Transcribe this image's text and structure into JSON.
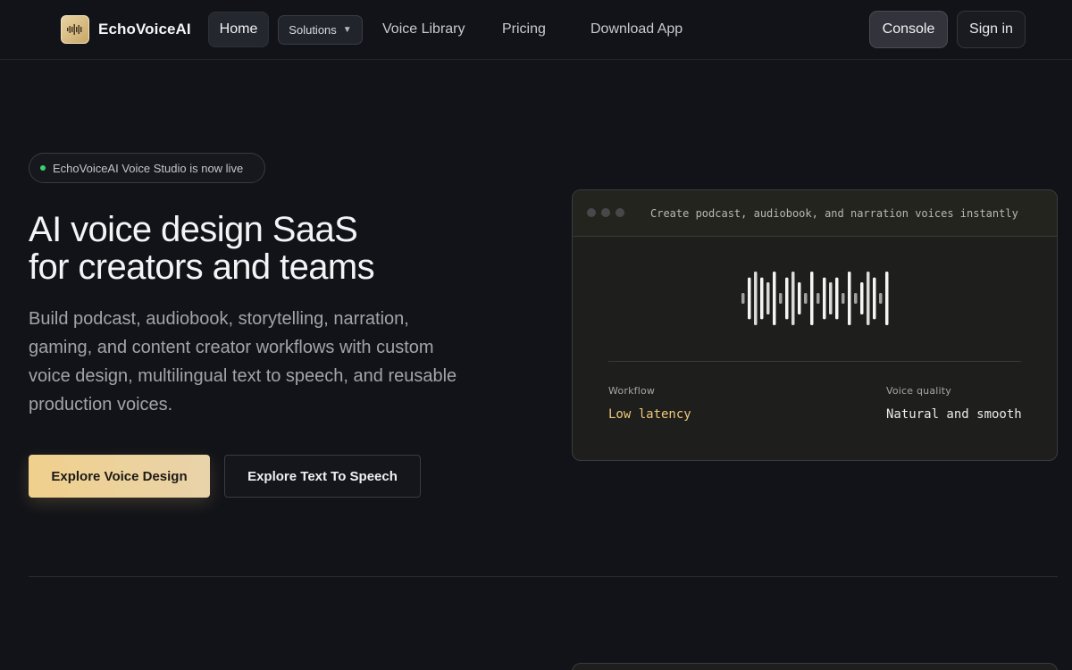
{
  "brand": {
    "name": "EchoVoiceAI",
    "logo_icon": "waveform-icon",
    "logo_color": "#e9d3a1"
  },
  "nav": {
    "home": "Home",
    "solutions": "Solutions",
    "voice_library": "Voice Library",
    "pricing": "Pricing",
    "download": "Download App",
    "console": "Console",
    "signin": "Sign in"
  },
  "hero": {
    "badge": "EchoVoiceAI Voice Studio is now live",
    "badge_status_color": "#3ecf6e",
    "title_line1": "AI voice design SaaS",
    "title_line2": "for creators and teams",
    "description": "Build podcast, audiobook, storytelling, narration, gaming, and content creator workflows with custom voice design, multilingual text to speech, and reusable production voices.",
    "primary_cta": "Explore Voice Design",
    "secondary_cta": "Explore Text To Speech",
    "accent_color": "#f0d08c"
  },
  "card": {
    "header_text": "Create podcast, audiobook, and narration voices instantly",
    "waveform_levels": [
      0.2,
      0.78,
      1.0,
      0.78,
      0.6,
      1.0,
      0.2,
      0.78,
      1.0,
      0.6,
      0.2,
      1.0,
      0.2,
      0.78,
      0.6,
      0.78,
      0.2,
      1.0,
      0.2,
      0.6,
      1.0,
      0.78,
      0.2,
      1.0
    ],
    "workflow_label": "Workflow",
    "workflow_value": "Low latency",
    "quality_label": "Voice quality",
    "quality_value": "Natural and smooth"
  }
}
